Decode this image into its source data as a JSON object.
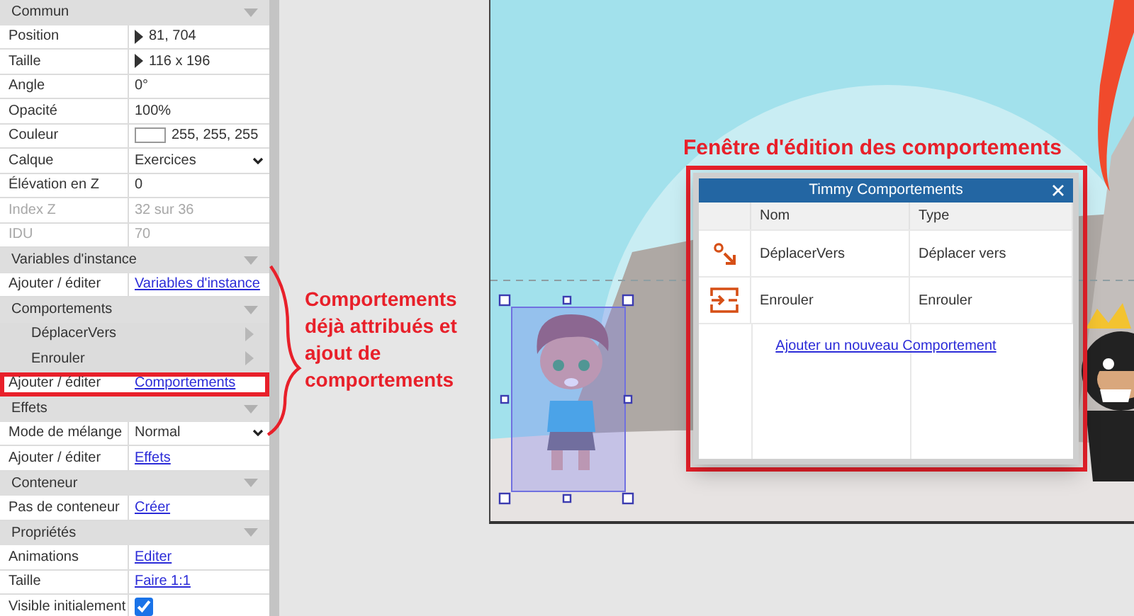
{
  "sidebar": {
    "sections": [
      {
        "title": "Commun",
        "expanded": true,
        "rows": [
          {
            "kind": "expander",
            "label": "Position",
            "value": "81, 704",
            "disabled": false,
            "highlighted": false
          },
          {
            "kind": "expander",
            "label": "Taille",
            "value": "116 x 196",
            "disabled": false,
            "highlighted": false
          },
          {
            "kind": "text",
            "label": "Angle",
            "value": "0°",
            "disabled": false,
            "highlighted": false
          },
          {
            "kind": "text",
            "label": "Opacité",
            "value": "100%",
            "disabled": false,
            "highlighted": false
          },
          {
            "kind": "color",
            "label": "Couleur",
            "value": "255, 255, 255",
            "disabled": false,
            "highlighted": false
          },
          {
            "kind": "select",
            "label": "Calque",
            "value": "Exercices",
            "disabled": false,
            "highlighted": false
          },
          {
            "kind": "text",
            "label": "Élévation en Z",
            "value": "0",
            "disabled": false,
            "highlighted": false
          },
          {
            "kind": "text",
            "label": "Index Z",
            "value": "32 sur 36",
            "disabled": true,
            "highlighted": false
          },
          {
            "kind": "text",
            "label": "IDU",
            "value": "70",
            "disabled": true,
            "highlighted": false
          }
        ]
      },
      {
        "title": "Variables d'instance",
        "expanded": true,
        "rows": [
          {
            "kind": "link",
            "label": "Ajouter / éditer",
            "value": "Variables d'instance",
            "disabled": false,
            "highlighted": false
          }
        ]
      },
      {
        "title": "Comportements",
        "expanded": true,
        "rows": [
          {
            "kind": "child",
            "label": "DéplacerVers",
            "disabled": false,
            "highlighted": false
          },
          {
            "kind": "child",
            "label": "Enrouler",
            "disabled": false,
            "highlighted": false
          },
          {
            "kind": "link",
            "label": "Ajouter / éditer",
            "value": "Comportements",
            "disabled": false,
            "highlighted": true
          }
        ]
      },
      {
        "title": "Effets",
        "expanded": true,
        "rows": [
          {
            "kind": "select",
            "label": "Mode de mélange",
            "value": "Normal",
            "disabled": false,
            "highlighted": false
          },
          {
            "kind": "link",
            "label": "Ajouter / éditer",
            "value": "Effets",
            "disabled": false,
            "highlighted": false
          }
        ]
      },
      {
        "title": "Conteneur",
        "expanded": true,
        "rows": [
          {
            "kind": "link",
            "label": "Pas de conteneur",
            "value": "Créer",
            "disabled": false,
            "highlighted": false
          }
        ]
      },
      {
        "title": "Propriétés",
        "expanded": true,
        "rows": [
          {
            "kind": "link",
            "label": "Animations",
            "value": "Editer",
            "disabled": false,
            "highlighted": false
          },
          {
            "kind": "link",
            "label": "Taille",
            "value": "Faire 1:1",
            "disabled": false,
            "highlighted": false
          },
          {
            "kind": "checkbox",
            "label": "Visible initialement",
            "checked": true,
            "disabled": false,
            "highlighted": false
          }
        ]
      }
    ]
  },
  "annotation_sidebar": {
    "text": "Comportements déjà attribués et ajout de comportements"
  },
  "annotation_dialog": {
    "text": "Fenêtre d'édition des comportements"
  },
  "dialog": {
    "title": "Timmy Comportements",
    "columns": [
      "Nom",
      "Type"
    ],
    "rows": [
      {
        "kind": "move",
        "name": "DéplacerVers",
        "type": "Déplacer vers"
      },
      {
        "kind": "wrap",
        "name": "Enrouler",
        "type": "Enrouler"
      }
    ],
    "add_link": "Ajouter un nouveau Comportement"
  }
}
